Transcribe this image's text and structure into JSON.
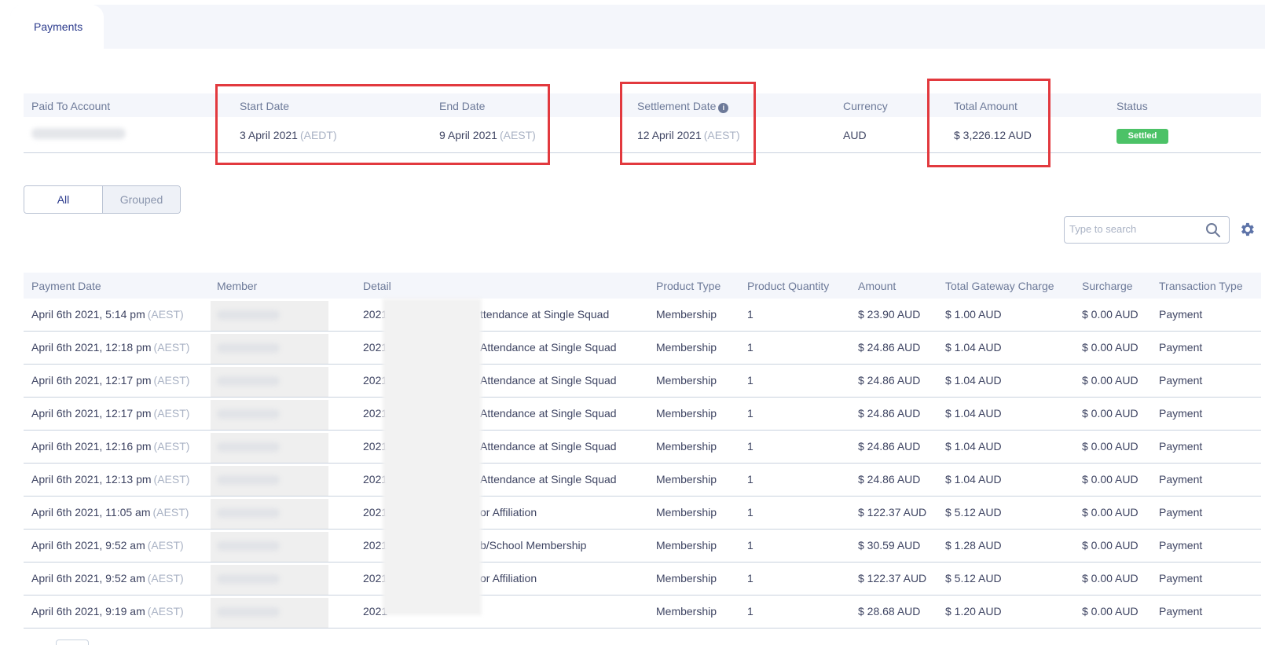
{
  "tabs": [
    {
      "label": "Payments",
      "active": true
    }
  ],
  "summary": {
    "headers": {
      "paid_to_account": "Paid To Account",
      "start_date": "Start Date",
      "end_date": "End Date",
      "settlement_date": "Settlement Date",
      "currency": "Currency",
      "total_amount": "Total Amount",
      "status": "Status"
    },
    "values": {
      "start_date": "3 April 2021",
      "start_tz": "(AEDT)",
      "end_date": "9 April 2021",
      "end_tz": "(AEST)",
      "settlement_date": "12 April 2021",
      "settlement_tz": "(AEST)",
      "currency": "AUD",
      "total_amount": "$ 3,226.12 AUD",
      "status": "Settled"
    },
    "status_color": "#4cc267",
    "info_icon": "info-icon"
  },
  "view_toggle": {
    "all": "All",
    "grouped": "Grouped",
    "selected": "All"
  },
  "search": {
    "placeholder": "Type to search"
  },
  "table": {
    "columns": [
      "Payment Date",
      "Member",
      "Detail",
      "Product Type",
      "Product Quantity",
      "Amount",
      "Total Gateway Charge",
      "Surcharge",
      "Transaction Type"
    ],
    "rows": [
      {
        "date": "April 6th 2021, 5:14 pm",
        "tz": "(AEST)",
        "detail_prefix": "2021",
        "detail_suffix": "ttendance at Single Squad",
        "product_type": "Membership",
        "qty": "1",
        "amount": "$ 23.90 AUD",
        "gateway": "$ 1.00 AUD",
        "surcharge": "$ 0.00 AUD",
        "txn": "Payment"
      },
      {
        "date": "April 6th 2021, 12:18 pm",
        "tz": "(AEST)",
        "detail_prefix": "2021",
        "detail_suffix": "Attendance at Single Squad",
        "product_type": "Membership",
        "qty": "1",
        "amount": "$ 24.86 AUD",
        "gateway": "$ 1.04 AUD",
        "surcharge": "$ 0.00 AUD",
        "txn": "Payment"
      },
      {
        "date": "April 6th 2021, 12:17 pm",
        "tz": "(AEST)",
        "detail_prefix": "2021",
        "detail_suffix": "Attendance at Single Squad",
        "product_type": "Membership",
        "qty": "1",
        "amount": "$ 24.86 AUD",
        "gateway": "$ 1.04 AUD",
        "surcharge": "$ 0.00 AUD",
        "txn": "Payment"
      },
      {
        "date": "April 6th 2021, 12:17 pm",
        "tz": "(AEST)",
        "detail_prefix": "2021",
        "detail_suffix": "Attendance at Single Squad",
        "product_type": "Membership",
        "qty": "1",
        "amount": "$ 24.86 AUD",
        "gateway": "$ 1.04 AUD",
        "surcharge": "$ 0.00 AUD",
        "txn": "Payment"
      },
      {
        "date": "April 6th 2021, 12:16 pm",
        "tz": "(AEST)",
        "detail_prefix": "2021",
        "detail_suffix": "Attendance at Single Squad",
        "product_type": "Membership",
        "qty": "1",
        "amount": "$ 24.86 AUD",
        "gateway": "$ 1.04 AUD",
        "surcharge": "$ 0.00 AUD",
        "txn": "Payment"
      },
      {
        "date": "April 6th 2021, 12:13 pm",
        "tz": "(AEST)",
        "detail_prefix": "2021",
        "detail_suffix": "Attendance at Single Squad",
        "product_type": "Membership",
        "qty": "1",
        "amount": "$ 24.86 AUD",
        "gateway": "$ 1.04 AUD",
        "surcharge": "$ 0.00 AUD",
        "txn": "Payment"
      },
      {
        "date": "April 6th 2021, 11:05 am",
        "tz": "(AEST)",
        "detail_prefix": "2021",
        "detail_suffix": "or Affiliation",
        "product_type": "Membership",
        "qty": "1",
        "amount": "$ 122.37 AUD",
        "gateway": "$ 5.12 AUD",
        "surcharge": "$ 0.00 AUD",
        "txn": "Payment"
      },
      {
        "date": "April 6th 2021, 9:52 am",
        "tz": "(AEST)",
        "detail_prefix": "2021",
        "detail_suffix": "b/School Membership",
        "product_type": "Membership",
        "qty": "1",
        "amount": "$ 30.59 AUD",
        "gateway": "$ 1.28 AUD",
        "surcharge": "$ 0.00 AUD",
        "txn": "Payment"
      },
      {
        "date": "April 6th 2021, 9:52 am",
        "tz": "(AEST)",
        "detail_prefix": "2021",
        "detail_suffix": "or Affiliation",
        "product_type": "Membership",
        "qty": "1",
        "amount": "$ 122.37 AUD",
        "gateway": "$ 5.12 AUD",
        "surcharge": "$ 0.00 AUD",
        "txn": "Payment"
      },
      {
        "date": "April 6th 2021, 9:19 am",
        "tz": "(AEST)",
        "detail_prefix": "2021",
        "detail_suffix": "",
        "product_type": "Membership",
        "qty": "1",
        "amount": "$ 28.68 AUD",
        "gateway": "$ 1.20 AUD",
        "surcharge": "$ 0.00 AUD",
        "txn": "Payment"
      }
    ]
  },
  "colors": {
    "accent": "#2b3a8c",
    "highlight": "#e2393e",
    "header_bg": "#f4f6fb"
  }
}
